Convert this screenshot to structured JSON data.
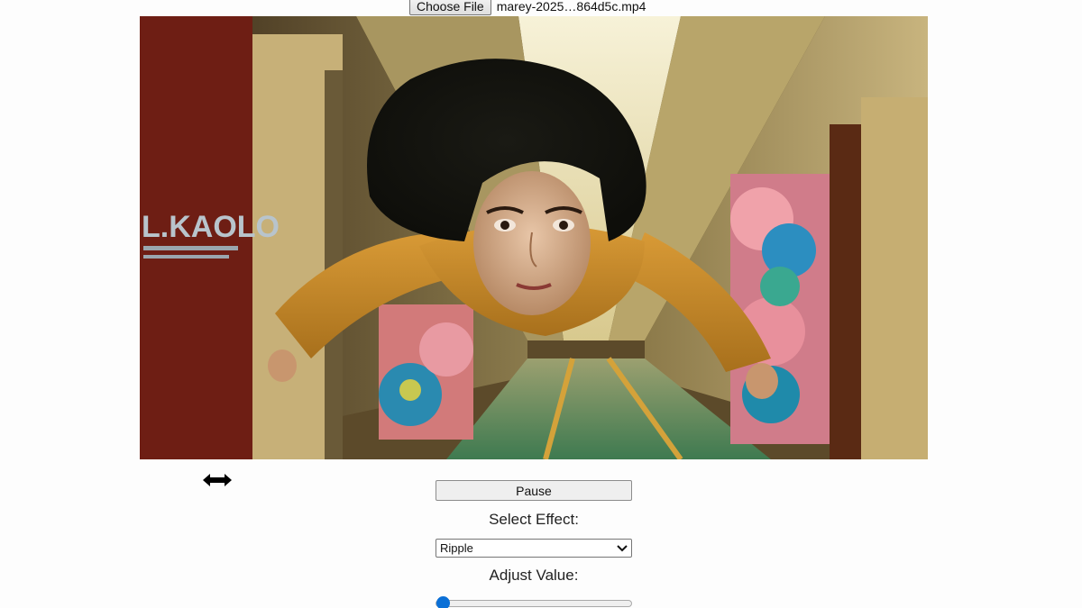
{
  "file_input": {
    "button_label": "Choose File",
    "file_name": "marey-2025…864d5c.mp4"
  },
  "video": {
    "state": "playing",
    "poster_text": "L.KAOLO"
  },
  "controls": {
    "pause_label": "Pause",
    "select_effect_label": "Select Effect:",
    "effect_selected": "Ripple",
    "adjust_value_label": "Adjust Value:",
    "slider_value": 0
  },
  "icons": {
    "resize": "horizontal-resize-icon",
    "dropdown": "chevron-down-icon"
  },
  "colors": {
    "slider_accent": "#0a6fd6",
    "page_background": "#fdfdfd"
  }
}
